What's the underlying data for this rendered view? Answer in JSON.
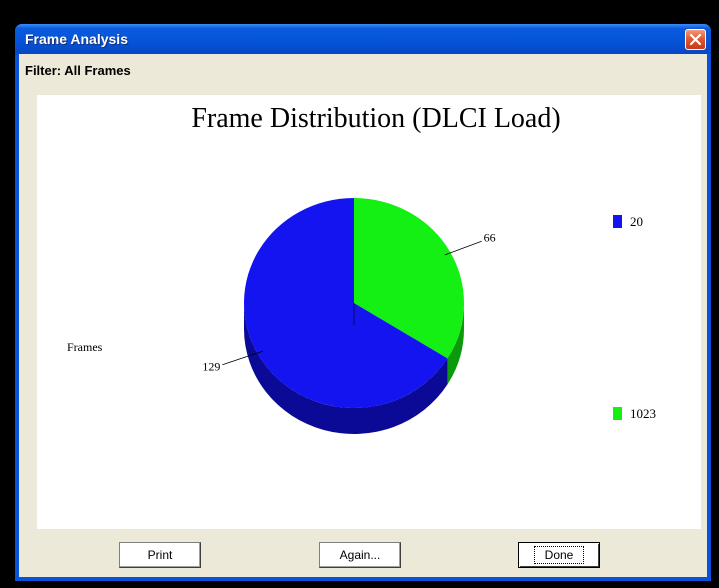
{
  "window": {
    "title": "Frame Analysis"
  },
  "filter": {
    "label": "Filter: All Frames"
  },
  "chart_data": {
    "type": "pie",
    "title": "Frame Distribution (DLCI Load)",
    "ylabel": "Frames",
    "categories": [
      "20",
      "1023"
    ],
    "values": [
      129,
      66
    ],
    "colors": [
      "#1414f0",
      "#14f014"
    ],
    "side_colors": [
      "#0a0a96",
      "#0a9a0a"
    ],
    "legend": [
      "20",
      "1023"
    ],
    "legend_position": "right",
    "style": "3d"
  },
  "buttons": {
    "print": "Print",
    "again": "Again...",
    "done": "Done"
  },
  "icons": {
    "close": "close-icon"
  }
}
